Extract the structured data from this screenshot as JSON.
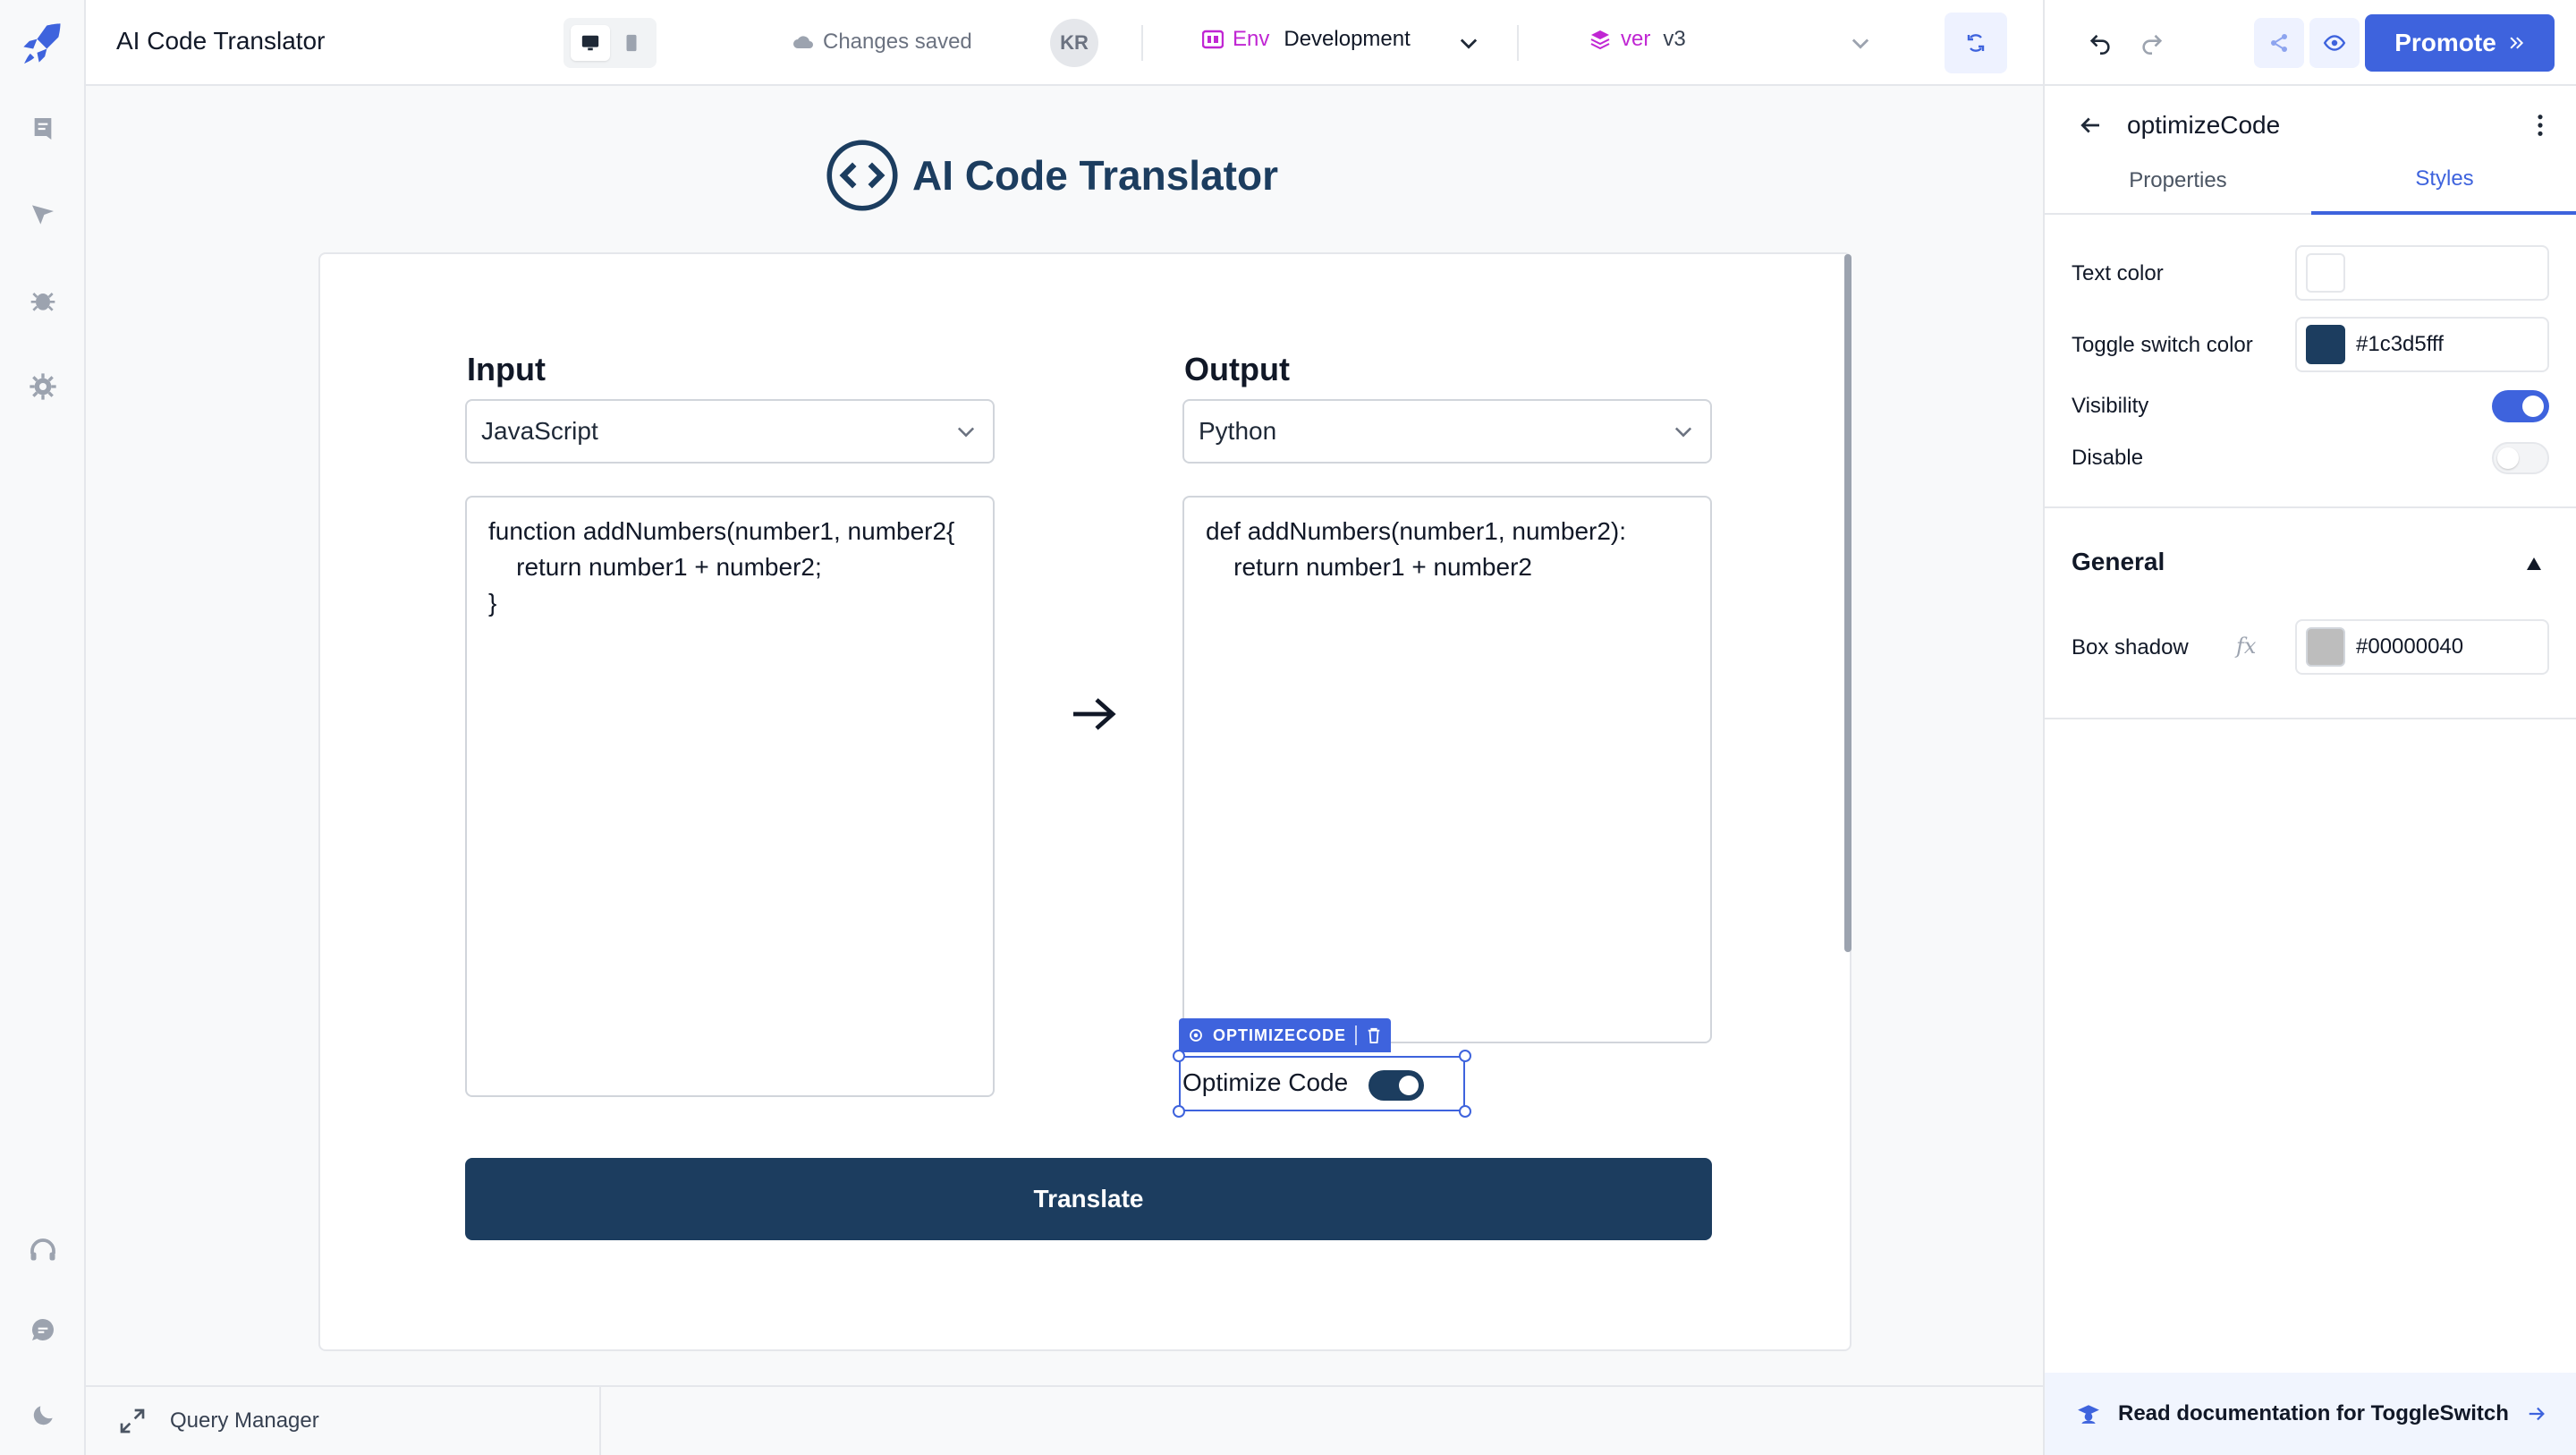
{
  "app": {
    "title": "AI Code Translator"
  },
  "topbar": {
    "save_status": "Changes saved",
    "user_initials": "KR",
    "env_label": "Env",
    "env_value": "Development",
    "version_label": "ver",
    "version_value": "v3",
    "promote_label": "Promote"
  },
  "canvas": {
    "page_title": "AI Code Translator",
    "input": {
      "label": "Input",
      "language": "JavaScript",
      "code": "function addNumbers(number1, number2{\n    return number1 + number2;\n}"
    },
    "output": {
      "label": "Output",
      "language": "Python",
      "code": "def addNumbers(number1, number2):\n    return number1 + number2"
    },
    "selected_component_tag": "OPTIMIZECODE",
    "optimize_label": "Optimize Code",
    "optimize_on": true,
    "translate_label": "Translate"
  },
  "query_manager": {
    "label": "Query Manager"
  },
  "panel": {
    "component_name": "optimizeCode",
    "tabs": [
      {
        "label": "Properties",
        "active": false
      },
      {
        "label": "Styles",
        "active": true
      }
    ],
    "text_color_label": "Text color",
    "text_color_value": "",
    "toggle_color_label": "Toggle switch color",
    "toggle_color_value": "#1c3d5fff",
    "visibility_label": "Visibility",
    "visibility_on": true,
    "disable_label": "Disable",
    "disable_on": false,
    "general_label": "General",
    "box_shadow_label": "Box shadow",
    "box_shadow_value": "#00000040",
    "fx_label": "fx",
    "doc_link": "Read documentation for ToggleSwitch"
  },
  "colors": {
    "brand": "#3e63dd",
    "navy": "#1c3d5f",
    "accent_magenta": "#c026d3"
  }
}
